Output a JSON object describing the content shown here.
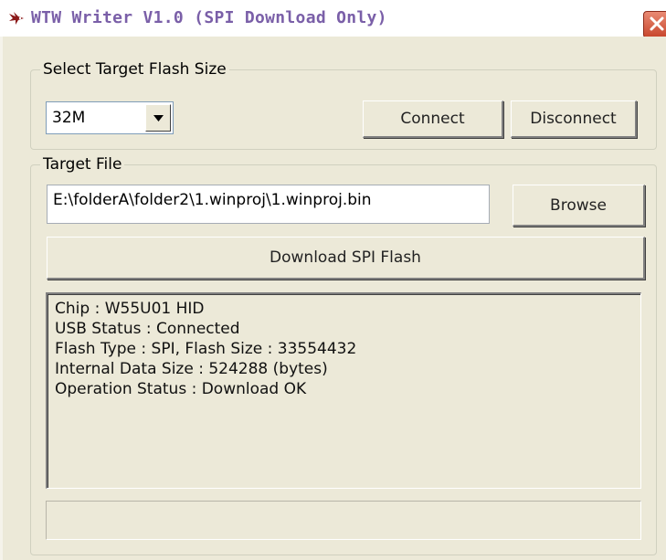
{
  "window": {
    "title": "WTW Writer V1.0 (SPI Download Only)",
    "icon": "bird-app-icon",
    "close_icon": "close-icon"
  },
  "flash_size_group": {
    "label": "Select Target Flash Size",
    "selected_size": "32M",
    "connect_label": "Connect",
    "disconnect_label": "Disconnect"
  },
  "target_file_group": {
    "label": "Target File",
    "file_path": "E:\\folderA\\folder2\\1.winproj\\1.winproj.bin",
    "browse_label": "Browse",
    "download_label": "Download SPI Flash"
  },
  "log": {
    "lines": [
      "Chip : W55U01 HID",
      "USB Status : Connected",
      "Flash Type : SPI, Flash Size : 33554432",
      "Internal Data Size : 524288 (bytes)",
      "Operation Status : Download OK"
    ]
  },
  "status_bar": {
    "text": ""
  },
  "colors": {
    "dialog_bg": "#ece9d8",
    "title_text": "#7a5fa8",
    "close_button": "#c7452c"
  }
}
